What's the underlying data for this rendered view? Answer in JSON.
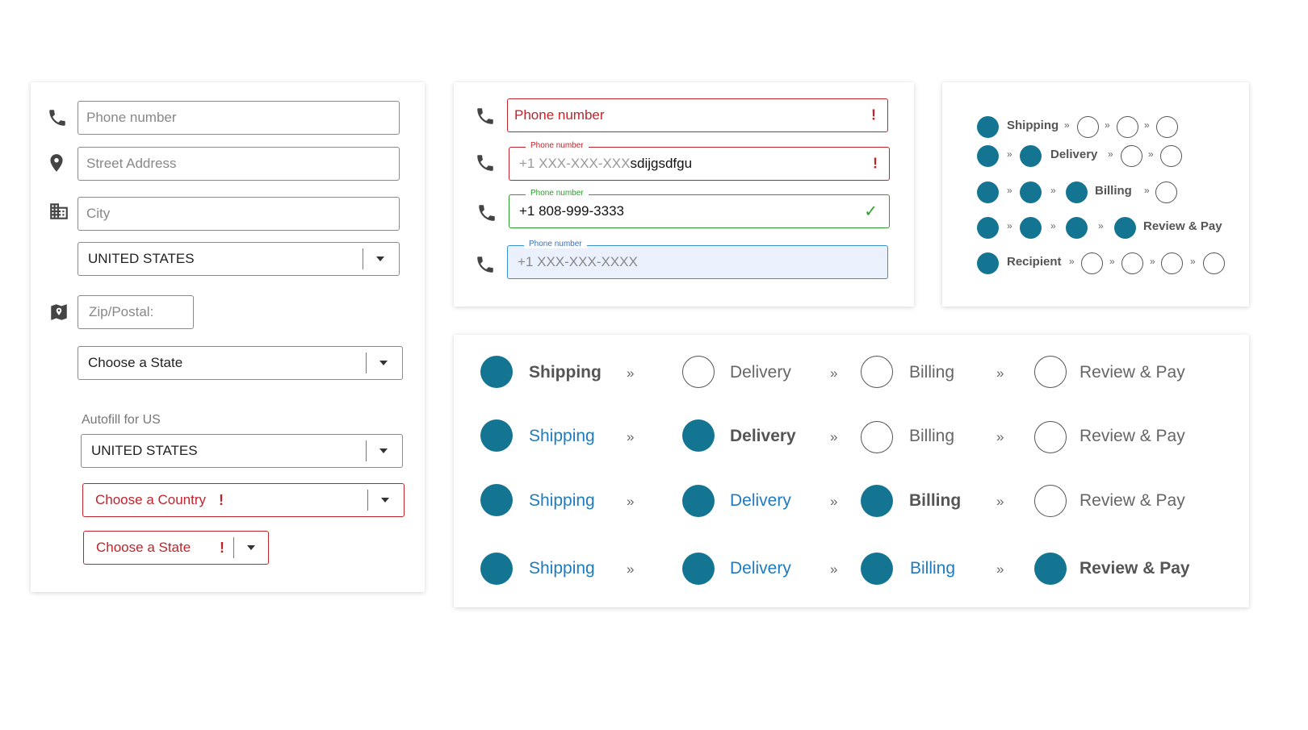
{
  "address_form": {
    "phone_placeholder": "Phone number",
    "street_placeholder": "Street Address",
    "city_placeholder": "City",
    "country_select_1": "UNITED STATES",
    "zip_placeholder": "Zip/Postal:",
    "state_select_1": "Choose a State",
    "autofill_label": "Autofill for US",
    "country_select_2": "UNITED STATES",
    "country_error": "Choose a Country",
    "state_error": "Choose a State",
    "error_mark": "!"
  },
  "phone_states": {
    "error_empty_label": "Phone number",
    "error_filled_label": "Phone number",
    "error_filled_prefix": "+1 XXX-XXX-XXX",
    "error_filled_value": "sdijgsdfgu",
    "success_label": "Phone number",
    "success_value": "+1 808-999-3333",
    "focus_label": "Phone number",
    "focus_placeholder": "+1 XXX-XXX-XXXX",
    "error_mark": "!",
    "success_mark": "✓"
  },
  "mini_steps": {
    "chevron": "»",
    "shipping": "Shipping",
    "delivery": "Delivery",
    "billing": "Billing",
    "review_pay": "Review & Pay",
    "recipient": "Recipient"
  },
  "big_steps": {
    "chevron": "»",
    "shipping": "Shipping",
    "delivery": "Delivery",
    "billing": "Billing",
    "review_pay": "Review & Pay"
  },
  "colors": {
    "step_filled": "#137591",
    "link_blue": "#1f7bbf",
    "error_red": "#c0242b",
    "success_green": "#2a9d2a",
    "focus_blue": "#3b8fd6",
    "focus_bg": "#eaf0fc"
  }
}
